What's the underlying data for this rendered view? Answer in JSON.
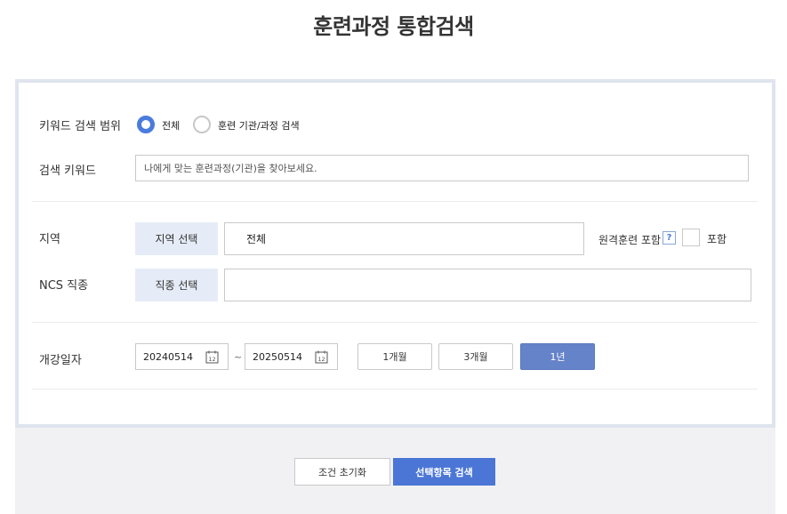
{
  "page": {
    "title": "훈련과정 통합검색"
  },
  "keyword_scope": {
    "label": "키워드 검색 범위",
    "options": [
      {
        "label": "전체",
        "checked": true
      },
      {
        "label": "훈련 기관/과정 검색",
        "checked": false
      }
    ]
  },
  "keyword": {
    "label": "검색 키워드",
    "placeholder": "나에게 맞는 훈련과정(기관)을 찾아보세요."
  },
  "region": {
    "label": "지역",
    "button_label": "지역 선택",
    "value": "전체",
    "remote_label": "원격훈련 포함",
    "help_icon": "?",
    "include_label": "포함"
  },
  "ncs": {
    "label": "NCS 직종",
    "button_label": "직종 선택",
    "value": ""
  },
  "start_date": {
    "label": "개강일자",
    "from": "20240514",
    "to": "20250514",
    "separator": "~",
    "calendar_text": "12",
    "periods": [
      {
        "label": "1개월",
        "active": false
      },
      {
        "label": "3개월",
        "active": false
      },
      {
        "label": "1년",
        "active": true
      }
    ]
  },
  "footer": {
    "reset_label": "조건 초기화",
    "search_label": "선택항목 검색"
  },
  "colors": {
    "accent": "#4b7bdc",
    "panel_border": "#dfe4ee",
    "select_bg": "#e6ecf7",
    "active_period": "#6583c9"
  }
}
